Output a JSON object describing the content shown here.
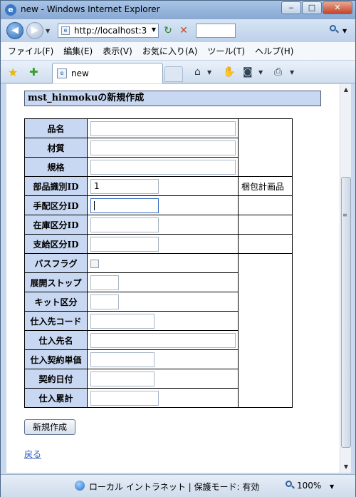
{
  "window": {
    "title": "new - Windows Internet Explorer"
  },
  "address": {
    "url": "http://localhost:3"
  },
  "menu": [
    "ファイル(F)",
    "編集(E)",
    "表示(V)",
    "お気に入り(A)",
    "ツール(T)",
    "ヘルプ(H)"
  ],
  "tab": {
    "label": "new"
  },
  "page": {
    "heading": "mst_hinmokuの新規作成",
    "fields": {
      "hinmei": {
        "label": "品名",
        "value": ""
      },
      "zaishitsu": {
        "label": "材質",
        "value": ""
      },
      "kikaku": {
        "label": "規格",
        "value": ""
      },
      "buhin_id": {
        "label": "部品識別ID",
        "value": "1",
        "side": "梱包計画品"
      },
      "tehai_id": {
        "label": "手配区分ID",
        "value": ""
      },
      "zaiko_id": {
        "label": "在庫区分ID",
        "value": ""
      },
      "shikyu_id": {
        "label": "支給区分ID",
        "value": ""
      },
      "bus_flag": {
        "label": "バスフラグ",
        "checked": false
      },
      "tenkai_stop": {
        "label": "展開ストップ",
        "value": ""
      },
      "kit_kubun": {
        "label": "キット区分",
        "value": ""
      },
      "shiiresaki_code": {
        "label": "仕入先コード",
        "value": ""
      },
      "shiiresaki_mei": {
        "label": "仕入先名",
        "value": ""
      },
      "keiyaku_tanka": {
        "label": "仕入契約単価",
        "value": ""
      },
      "keiyaku_hiduke": {
        "label": "契約日付",
        "value": ""
      },
      "shiire_ruikei": {
        "label": "仕入累計",
        "value": ""
      }
    },
    "submit_label": "新規作成",
    "back_label": "戻る"
  },
  "status": {
    "zone_text": "ローカル イントラネット | 保護モード: 有効",
    "zoom": "100%"
  }
}
